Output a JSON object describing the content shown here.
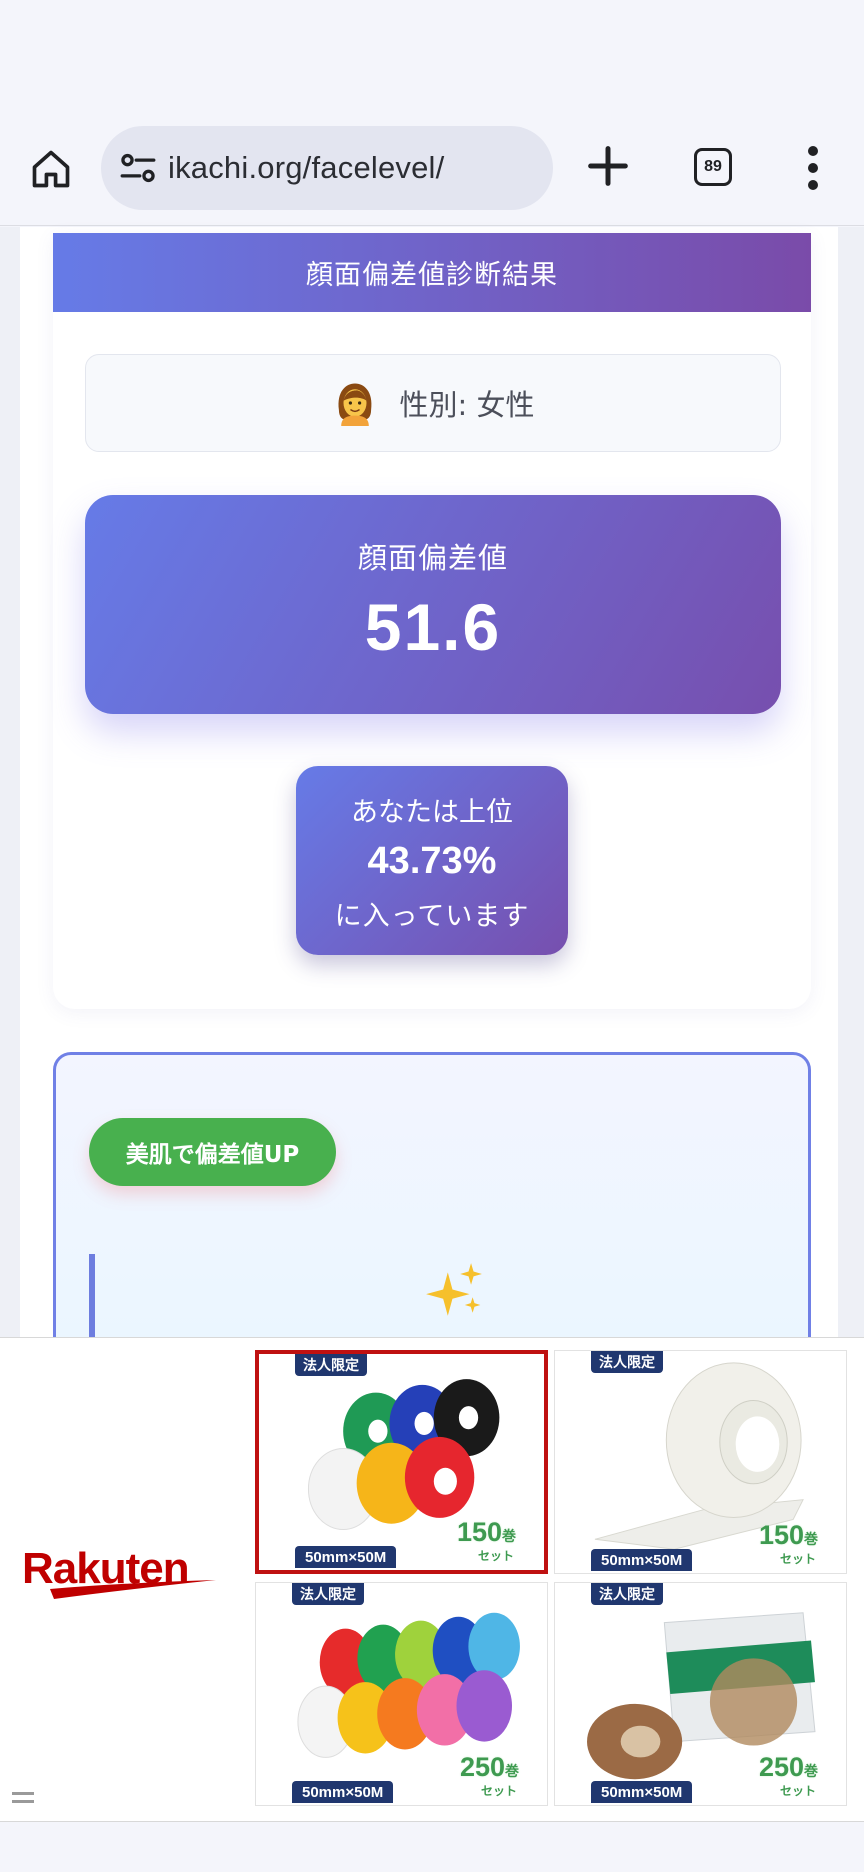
{
  "browser": {
    "url": "ikachi.org/facelevel/",
    "tab_count": "89",
    "icons": [
      "home-icon",
      "site-settings-icon",
      "new-tab-icon",
      "tab-switcher-icon",
      "more-menu-icon"
    ]
  },
  "result": {
    "header": "顔面偏差値診断結果",
    "gender_emoji": "woman-emoji",
    "gender_text": "性別: 女性",
    "score_label": "顔面偏差値",
    "score_value": "51.6",
    "rank_pre": "あなたは上位",
    "rank_value": "43.73%",
    "rank_post": "に入っています"
  },
  "tips": {
    "badge": "美肌で偏差値UP",
    "icon": "sparkles-icon"
  },
  "ad": {
    "brand": "Rakuten",
    "brand_color": "#bf0000",
    "products": [
      {
        "tag": "法人限定",
        "size": "50mm×50M",
        "qty": "150",
        "qty_unit": "巻",
        "qty_set": "セット",
        "kind": "colored-tape-6-rolls",
        "selected": true
      },
      {
        "tag": "法人限定",
        "size": "50mm×50M",
        "qty": "150",
        "qty_unit": "巻",
        "qty_set": "セット",
        "kind": "white-masking-tape",
        "selected": false
      },
      {
        "tag": "法人限定",
        "size": "50mm×50M",
        "qty": "250",
        "qty_unit": "巻",
        "qty_set": "セット",
        "kind": "colored-tape-10-rolls",
        "selected": false
      },
      {
        "tag": "法人限定",
        "size": "50mm×50M",
        "qty": "250",
        "qty_unit": "巻",
        "qty_set": "セット",
        "kind": "kraft-tape",
        "selected": false
      }
    ]
  },
  "colors": {
    "gradient_start": "#667be7",
    "gradient_end": "#774fae",
    "badge_green": "#48b04e",
    "tips_border": "#7080e6"
  }
}
